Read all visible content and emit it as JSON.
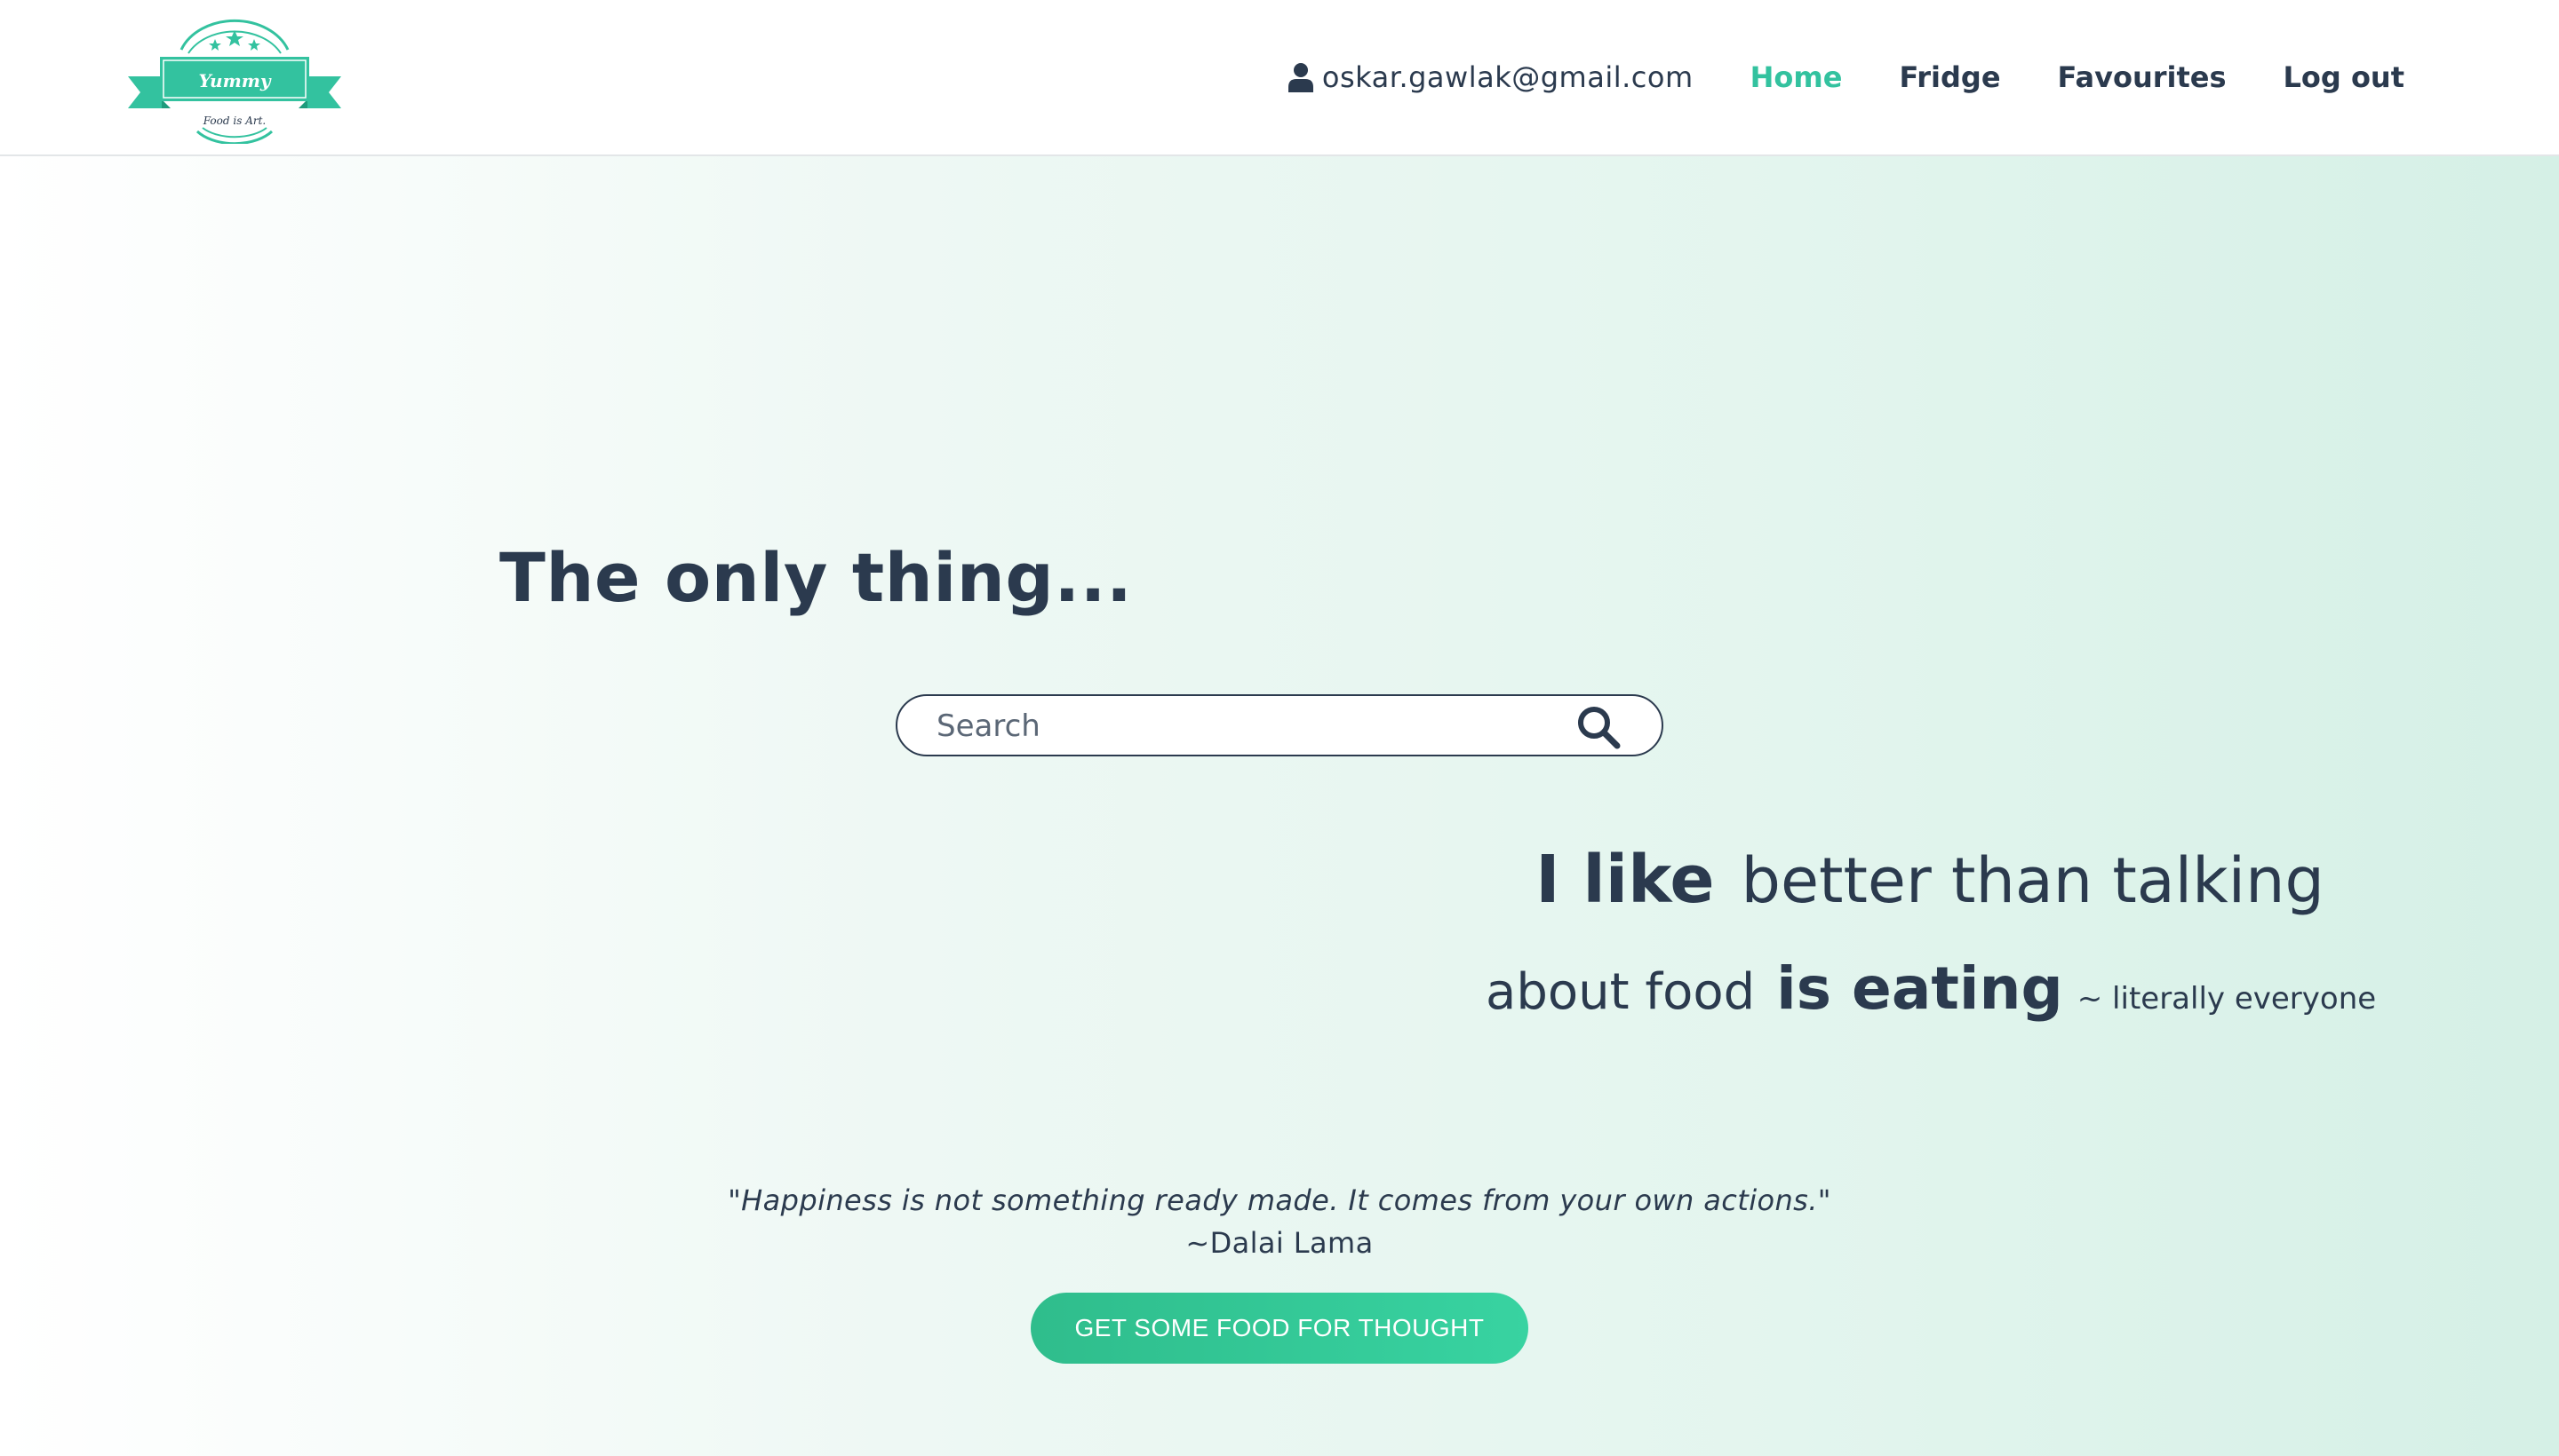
{
  "brand": {
    "name": "Yummy",
    "slogan": "Food is Art.",
    "accent_color": "#33c29f"
  },
  "nav": {
    "user_icon": "user-icon",
    "user_email": "oskar.gawlak@gmail.com",
    "links": [
      {
        "label": "Home",
        "active": true
      },
      {
        "label": "Fridge",
        "active": false
      },
      {
        "label": "Favourites",
        "active": false
      },
      {
        "label": "Log out",
        "active": false
      }
    ]
  },
  "hero": {
    "headline": "The only thing...",
    "search": {
      "placeholder": "Search",
      "value": "",
      "icon": "search-icon"
    },
    "tagline": {
      "part1": "I like",
      "part2": "better than talking",
      "part3": "about food",
      "part4": "is eating",
      "author": "~ literally everyone"
    },
    "quote": {
      "text": "\"Happiness is not something ready made. It comes from your own actions.\"",
      "author": "~Dalai Lama"
    },
    "cta_label": "GET SOME FOOD FOR THOUGHT"
  },
  "colors": {
    "text_dark": "#2b3a4e",
    "button_start": "#2fbd8c",
    "button_end": "#38d3a1"
  }
}
